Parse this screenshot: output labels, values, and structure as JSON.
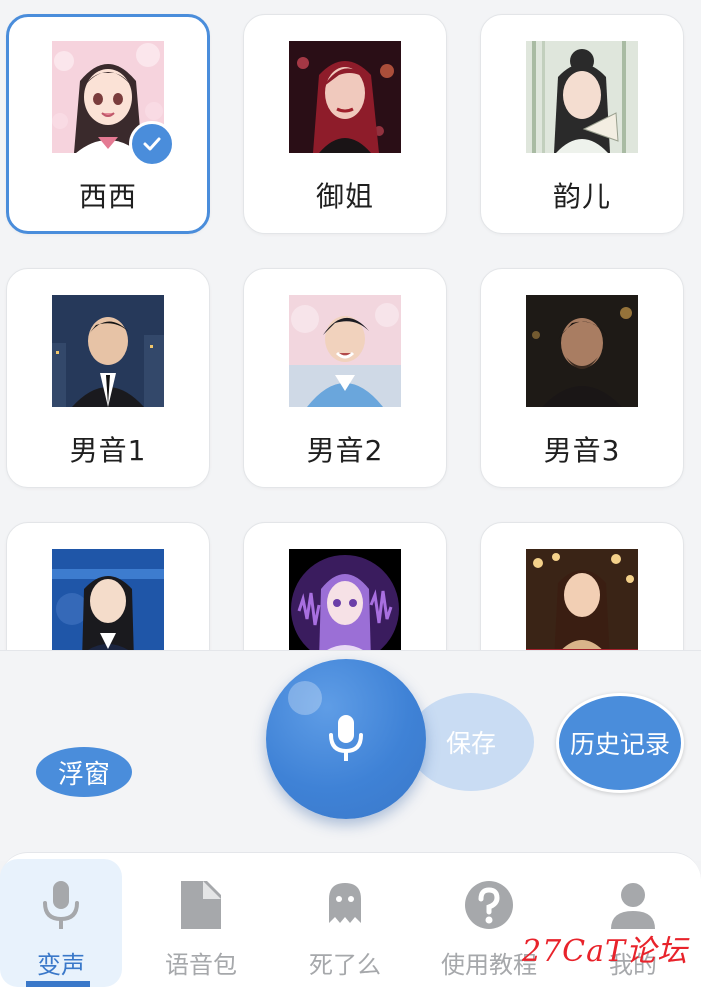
{
  "voices": [
    {
      "label": "西西",
      "selected": true
    },
    {
      "label": "御姐",
      "selected": false
    },
    {
      "label": "韵儿",
      "selected": false
    },
    {
      "label": "男音1",
      "selected": false
    },
    {
      "label": "男音2",
      "selected": false
    },
    {
      "label": "男音3",
      "selected": false
    },
    {
      "label": "",
      "selected": false
    },
    {
      "label": "",
      "selected": false
    },
    {
      "label": "",
      "selected": false
    }
  ],
  "controls": {
    "float_label": "浮窗",
    "mic_icon": "microphone-icon",
    "save_label": "保存",
    "history_label": "历史记录"
  },
  "tabs": [
    {
      "label": "变声",
      "icon": "microphone-icon",
      "active": true
    },
    {
      "label": "语音包",
      "icon": "file-icon",
      "active": false
    },
    {
      "label": "死了么",
      "icon": "ghost-icon",
      "active": false
    },
    {
      "label": "使用教程",
      "icon": "help-icon",
      "active": false
    },
    {
      "label": "我的",
      "icon": "user-icon",
      "active": false
    }
  ],
  "watermark": "27CaT论坛",
  "colors": {
    "accent": "#4a8ddb",
    "accent_dark": "#3a78c9",
    "save_disabled": "#c9dcf3",
    "tab_inactive": "#a6a8ab",
    "watermark": "#e8232b"
  }
}
